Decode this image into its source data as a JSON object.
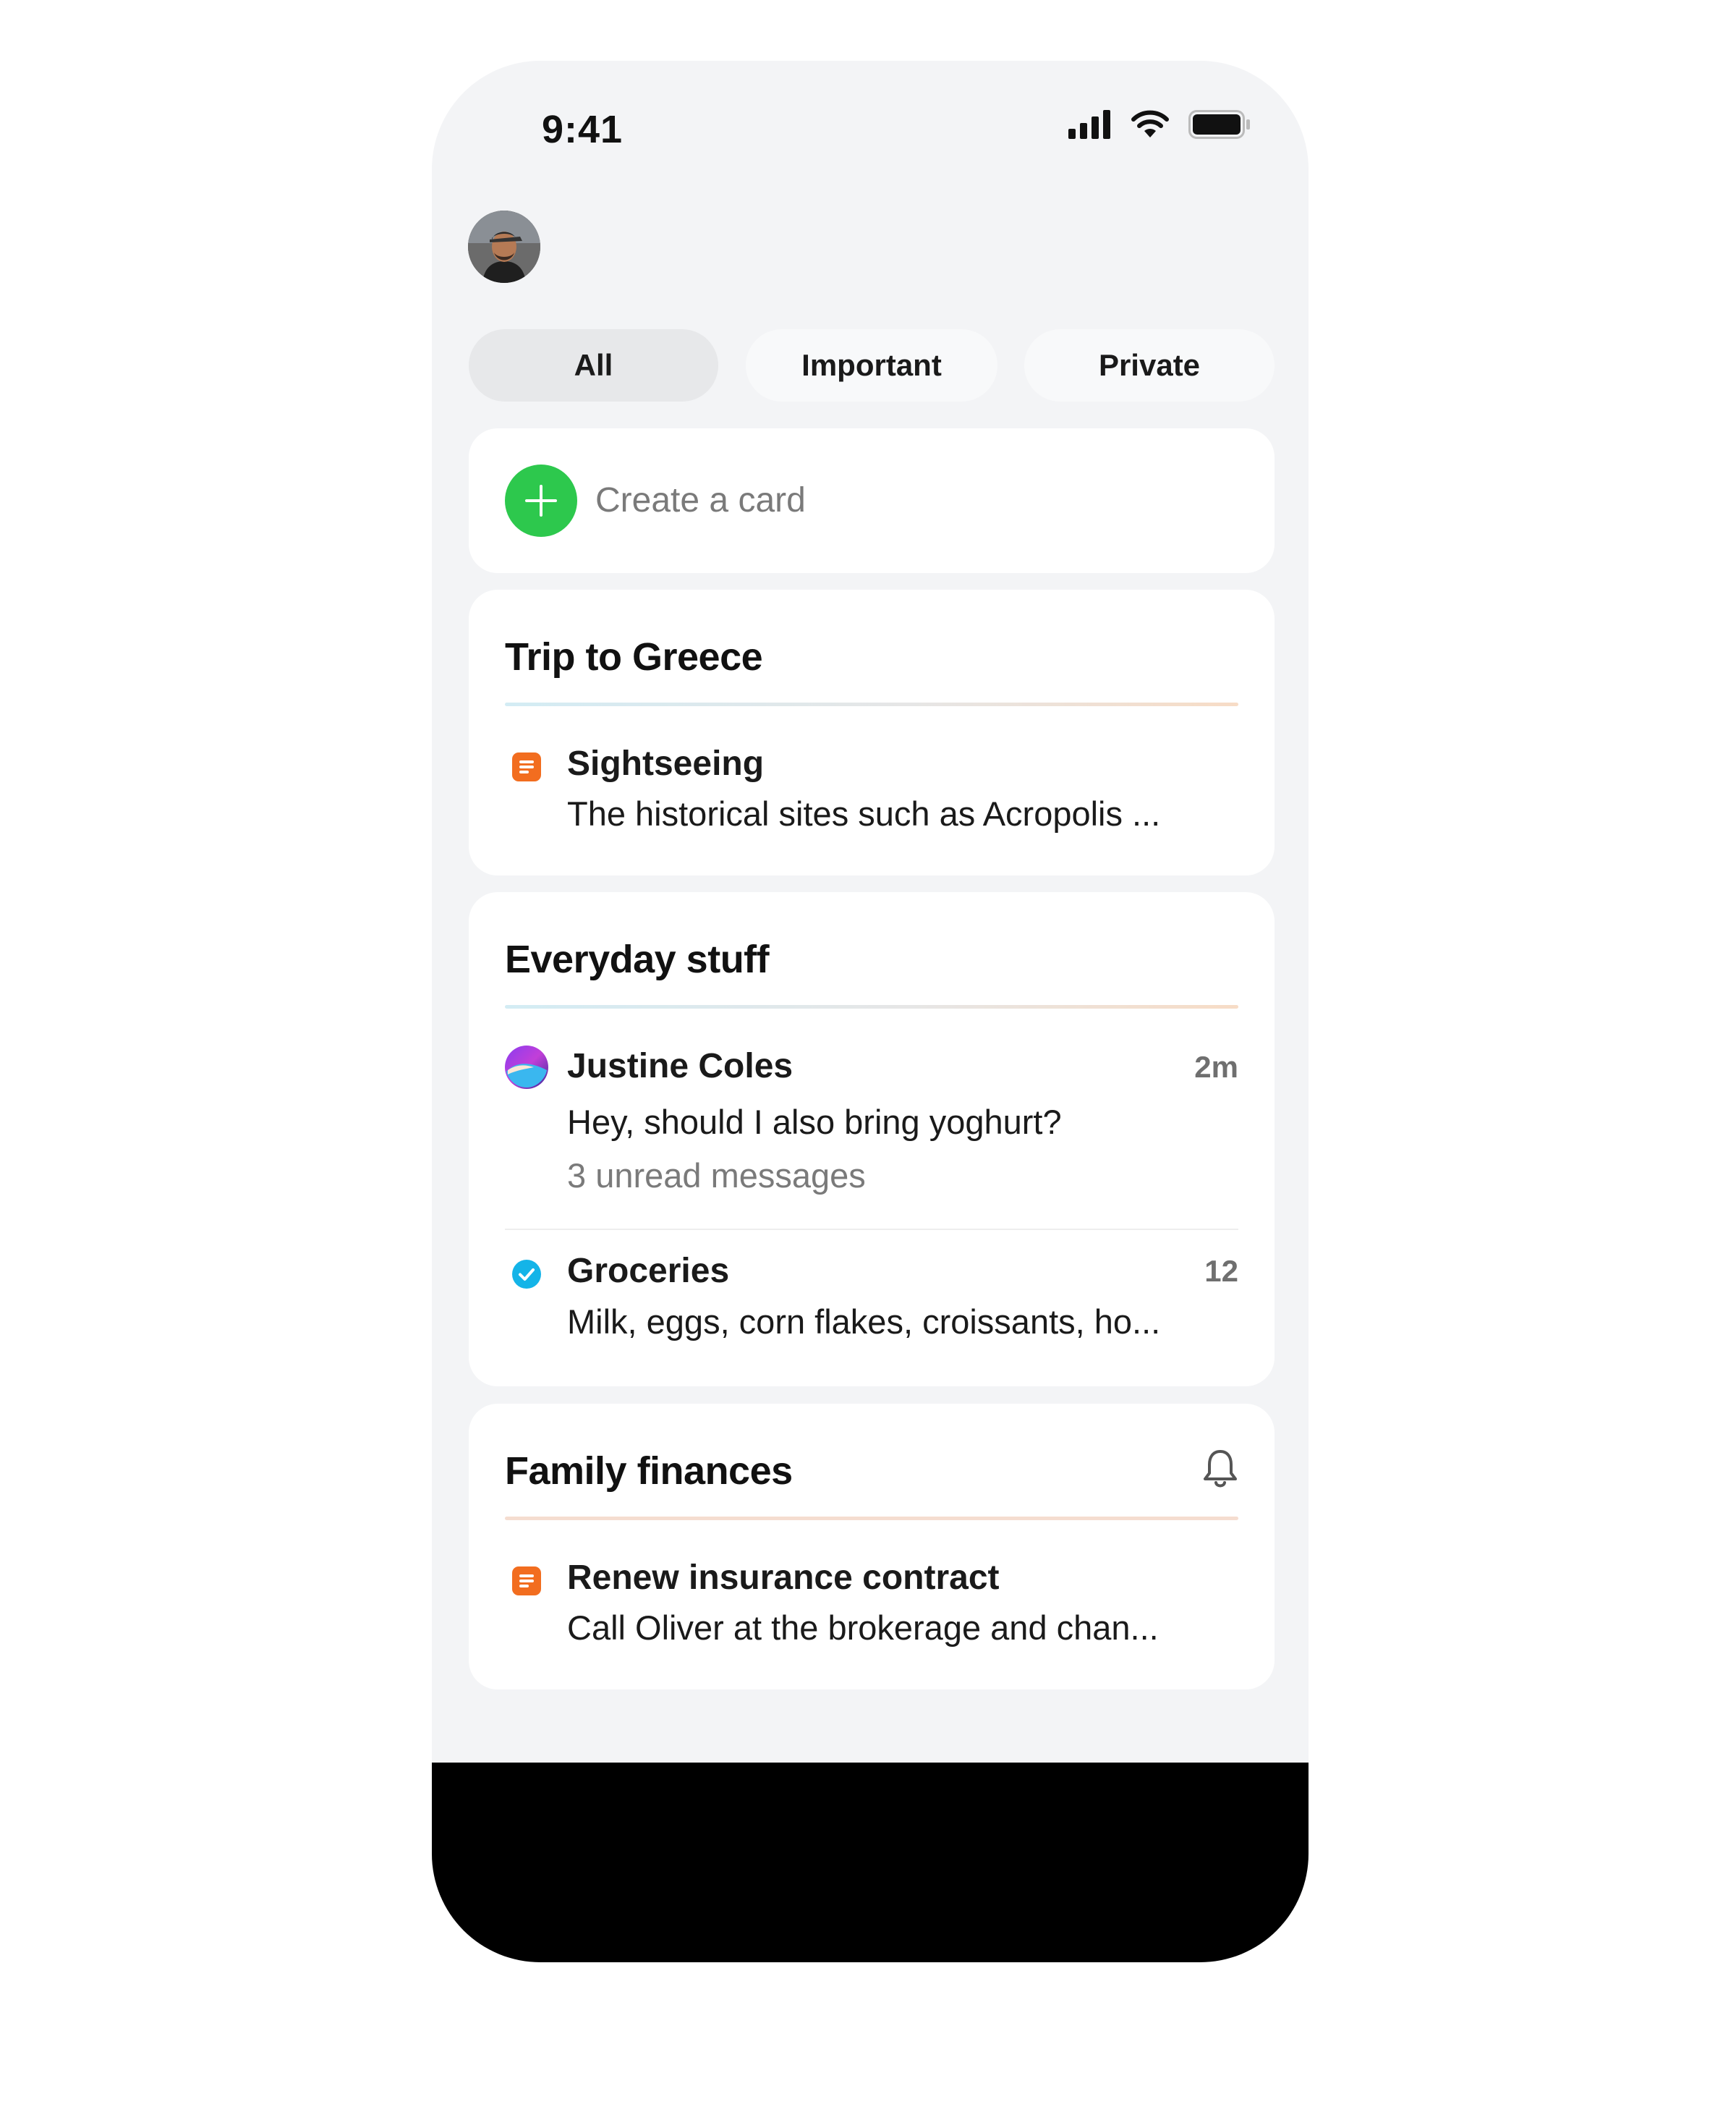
{
  "status_bar": {
    "time": "9:41"
  },
  "filters": [
    {
      "label": "All",
      "active": true
    },
    {
      "label": "Important",
      "active": false
    },
    {
      "label": "Private",
      "active": false
    }
  ],
  "create_card": {
    "label": "Create a card"
  },
  "cards": [
    {
      "title": "Trip to Greece",
      "items": [
        {
          "icon": "note-icon",
          "title": "Sightseeing",
          "subtitle": "The historical sites such as Acropolis ..."
        }
      ]
    },
    {
      "title": "Everyday stuff",
      "items": [
        {
          "icon": "contact-avatar",
          "title": "Justine Coles",
          "meta": "2m",
          "subtitle": "Hey, should I also bring yoghurt?",
          "unread": "3 unread messages"
        },
        {
          "icon": "check-circle-icon",
          "title": "Groceries",
          "meta": "12",
          "subtitle": "Milk, eggs, corn flakes, croissants, ho..."
        }
      ]
    },
    {
      "title": "Family finances",
      "header_icon": "bell-icon",
      "items": [
        {
          "icon": "note-icon",
          "title": "Renew insurance contract",
          "subtitle": "Call Oliver at the brokerage and chan..."
        }
      ]
    }
  ],
  "colors": {
    "accent_green": "#2dc84d",
    "note_orange": "#f26d1f",
    "check_blue": "#14b4e8",
    "background": "#f3f4f6"
  }
}
